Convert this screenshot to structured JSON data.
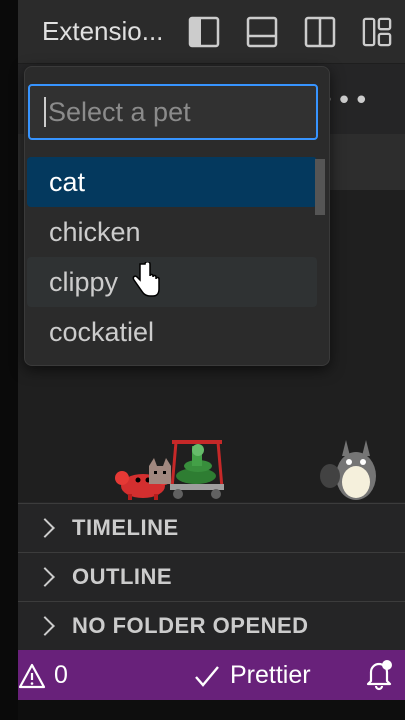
{
  "titlebar": {
    "title": "Extensio...",
    "icons": [
      "toggle-primary-sidebar-icon",
      "toggle-panel-icon",
      "toggle-secondary-sidebar-icon",
      "customize-layout-icon"
    ]
  },
  "panel": {
    "more_actions": "•••"
  },
  "quick_pick": {
    "placeholder": "Select a pet",
    "items": [
      {
        "label": "cat",
        "state": "selected"
      },
      {
        "label": "chicken",
        "state": "normal"
      },
      {
        "label": "clippy",
        "state": "hover"
      },
      {
        "label": "cockatiel",
        "state": "normal"
      }
    ]
  },
  "sections": [
    {
      "label": "TIMELINE"
    },
    {
      "label": "OUTLINE"
    },
    {
      "label": "NO FOLDER OPENED"
    }
  ],
  "statusbar": {
    "warnings_count": "0",
    "prettier_label": "Prettier",
    "color": "#68217a"
  },
  "colors": {
    "accent": "#3794ff",
    "selection": "#04395e"
  }
}
